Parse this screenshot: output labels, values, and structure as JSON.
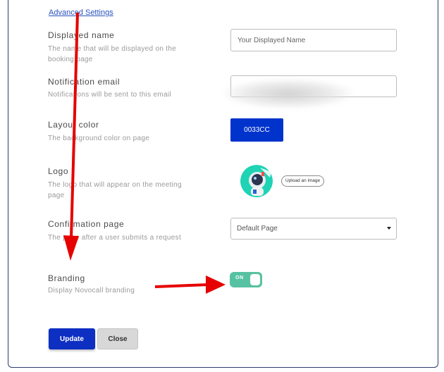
{
  "advanced_settings_link": "Advanced Settings",
  "fields": {
    "displayed_name": {
      "label": "Displayed name",
      "description": "The name that will be displayed on the booking page",
      "placeholder": "Your Displayed Name"
    },
    "notification_email": {
      "label": "Notification email",
      "description": "Notifications will be sent to this email"
    },
    "layout_color": {
      "label": "Layout color",
      "description": "The background color on page",
      "value": "0033CC",
      "color": "#0033cc"
    },
    "logo": {
      "label": "Logo",
      "description": "The logo that will appear on the meeting page",
      "upload_label": "Upload an image"
    },
    "confirmation_page": {
      "label": "Confirmation page",
      "description": "The page after a user submits a request",
      "selected": "Default Page"
    },
    "branding": {
      "label": "Branding",
      "description": "Display Novocall branding",
      "toggle_label": "ON",
      "toggle_color": "#57c2a2"
    }
  },
  "buttons": {
    "update": "Update",
    "close": "Close"
  },
  "annotation_color": "#e60000"
}
